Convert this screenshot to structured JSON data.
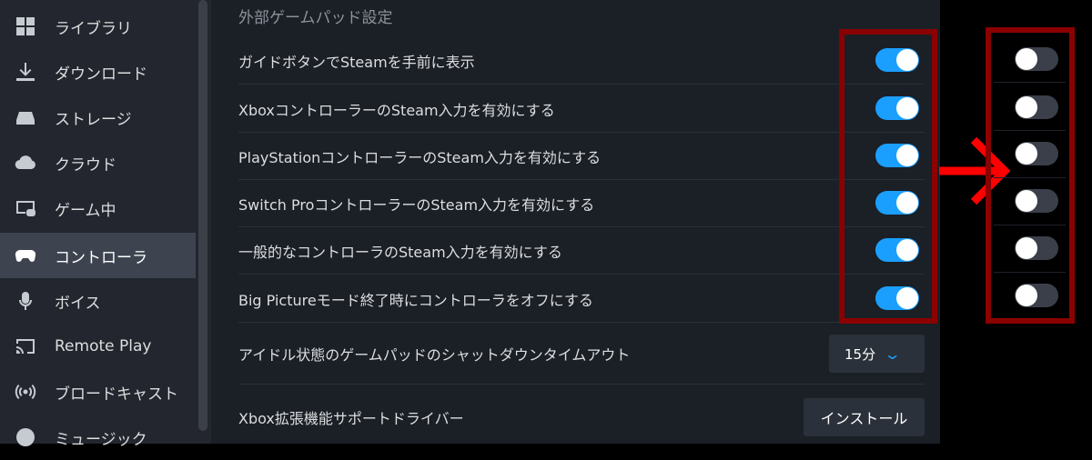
{
  "sidebar": {
    "items": [
      {
        "label": "ライブラリ",
        "icon": "grid-icon",
        "active": false
      },
      {
        "label": "ダウンロード",
        "icon": "download-icon",
        "active": false
      },
      {
        "label": "ストレージ",
        "icon": "storage-icon",
        "active": false
      },
      {
        "label": "クラウド",
        "icon": "cloud-icon",
        "active": false
      },
      {
        "label": "ゲーム中",
        "icon": "in-game-icon",
        "active": false
      },
      {
        "label": "コントローラ",
        "icon": "gamepad-icon",
        "active": true
      },
      {
        "label": "ボイス",
        "icon": "microphone-icon",
        "active": false
      },
      {
        "label": "Remote Play",
        "icon": "cast-icon",
        "active": false
      },
      {
        "label": "ブロードキャスト",
        "icon": "broadcast-icon",
        "active": false
      },
      {
        "label": "ミュージック",
        "icon": "music-icon",
        "active": false
      }
    ]
  },
  "main": {
    "section_title": "外部ゲームパッド設定",
    "toggles": [
      {
        "label": "ガイドボタンでSteamを手前に表示",
        "on": true
      },
      {
        "label": "XboxコントローラーのSteam入力を有効にする",
        "on": true
      },
      {
        "label": "PlayStationコントローラーのSteam入力を有効にする",
        "on": true
      },
      {
        "label": "Switch ProコントローラーのSteam入力を有効にする",
        "on": true
      },
      {
        "label": "一般的なコントローラのSteam入力を有効にする",
        "on": true
      },
      {
        "label": "Big Pictureモード終了時にコントローラをオフにする",
        "on": true
      }
    ],
    "idle_timeout": {
      "label": "アイドル状態のゲームパッドのシャットダウンタイムアウト",
      "value": "15分"
    },
    "xbox_driver": {
      "label": "Xbox拡張機能サポートドライバー",
      "button": "インストール"
    }
  },
  "comparison": {
    "toggles_off_count": 6,
    "arrow_color": "#ff0000",
    "box_color": "#8b0000",
    "accent": "#1a9fff"
  }
}
